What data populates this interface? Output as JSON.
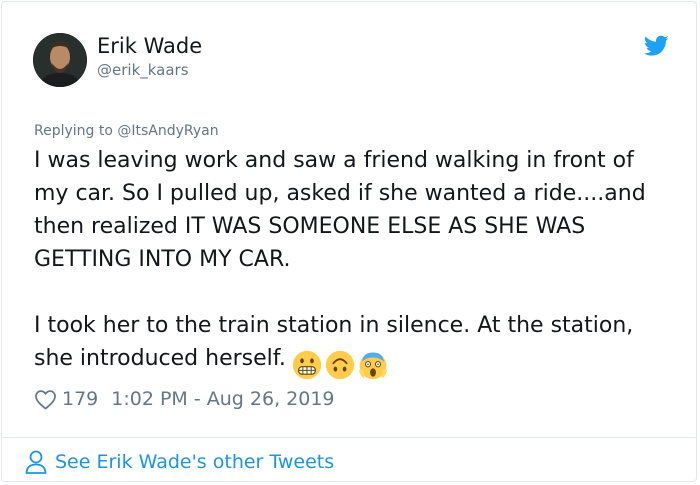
{
  "author": {
    "display_name": "Erik Wade",
    "handle": "@erik_kaars"
  },
  "tweet": {
    "replying_to_prefix": "Replying to",
    "replying_to_handle": "@ItsAndyRyan",
    "paragraph_1": "I was leaving work and saw a friend walking in front of my car. So I pulled up, asked if she wanted a ride....and then realized IT WAS SOMEONE ELSE AS SHE WAS GETTING INTO MY CAR.",
    "paragraph_2": "I took her to the train station in silence. At the station, she introduced herself.",
    "emojis": [
      "grimacing-face",
      "upside-down-face",
      "face-screaming-in-fear"
    ]
  },
  "stats": {
    "likes": "179",
    "timestamp": "1:02 PM - Aug 26, 2019"
  },
  "footer": {
    "see_more": "See Erik Wade's other Tweets"
  },
  "colors": {
    "accent": "#1da1f2",
    "link": "#1b95e0",
    "muted": "#657786",
    "text": "#14171a",
    "border": "#e1e8ed"
  },
  "icons": {
    "brand": "twitter-bird-icon",
    "like": "heart-outline-icon",
    "profile": "person-outline-icon"
  }
}
